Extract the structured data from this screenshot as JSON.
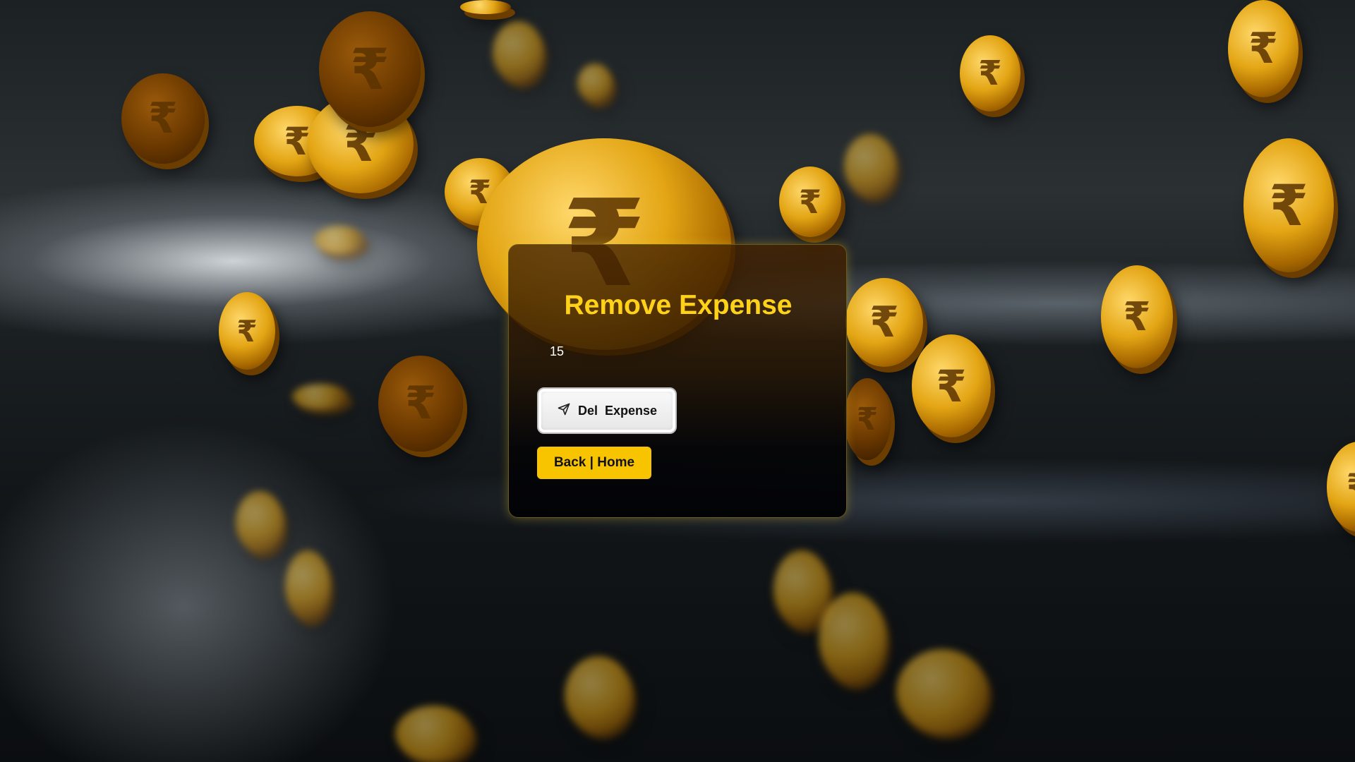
{
  "form": {
    "title": "Remove Expense",
    "expense_id_value": "15",
    "delete_button_label": "Del  Expense",
    "delete_button_icon": "send-icon",
    "back_button_label": "Back | Home"
  },
  "background": {
    "description_icon": "gold-coins-background",
    "coin_symbol": "₹"
  },
  "colors": {
    "title": "#ffd21a",
    "back_button": "#f8c400",
    "delete_button": "#eeeeee"
  }
}
